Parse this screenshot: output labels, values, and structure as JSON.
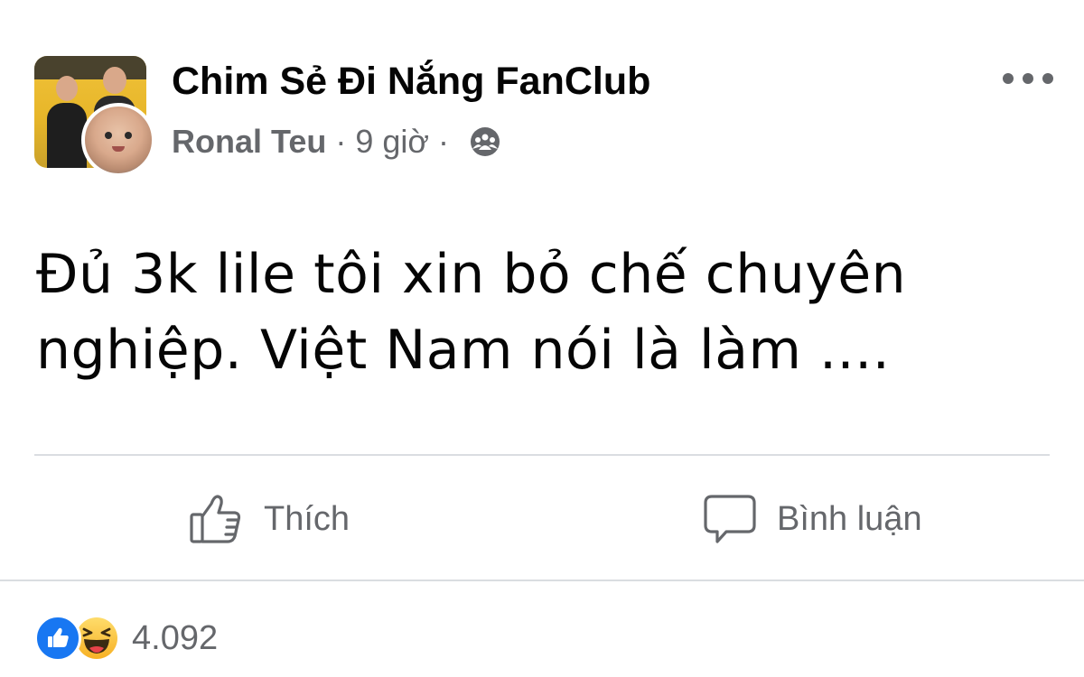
{
  "header": {
    "group_name": "Chim Sẻ Đi Nắng FanClub",
    "author": "Ronal Teu",
    "separator": "·",
    "time": "9 giờ",
    "privacy_icon": "group-privacy-icon",
    "more_icon": "more-options-icon"
  },
  "post": {
    "text": "Đủ 3k lile tôi xin bỏ chế chuyên nghiệp. Việt Nam nói là làm ...."
  },
  "actions": {
    "like_label": "Thích",
    "comment_label": "Bình luận"
  },
  "reactions": {
    "types": [
      "like",
      "haha"
    ],
    "count": "4.092"
  },
  "colors": {
    "text_primary": "#050505",
    "text_secondary": "#65676b",
    "divider": "#dadde1",
    "like_blue": "#1877f2",
    "haha_yellow": "#f7b125"
  }
}
